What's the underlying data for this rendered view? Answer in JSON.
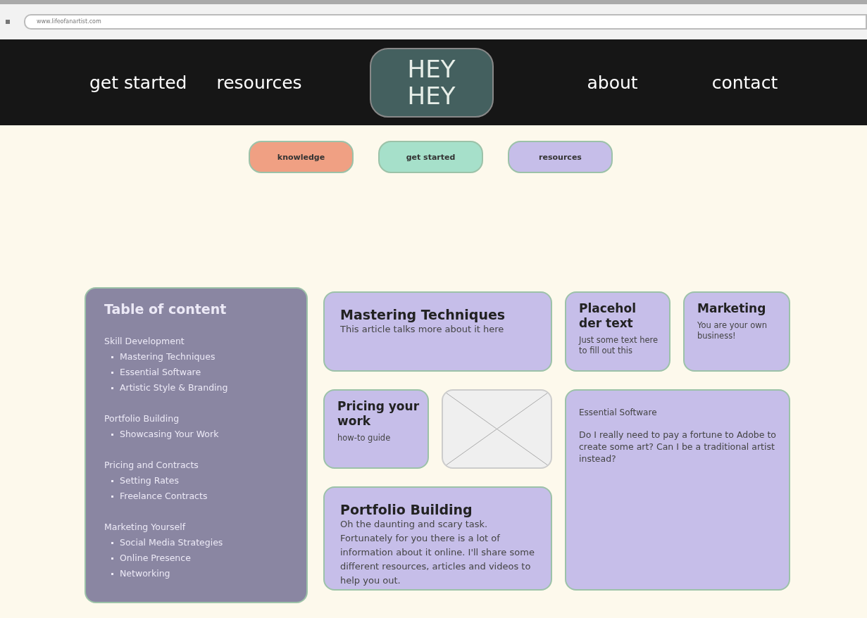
{
  "browser": {
    "address": "www.lifeofanartist.com"
  },
  "nav": {
    "left": [
      "get started",
      "resources"
    ],
    "logo": [
      "HEY",
      "HEY"
    ],
    "right": [
      "about",
      "contact"
    ]
  },
  "pills": [
    {
      "label": "knowledge",
      "color": "#f0a083"
    },
    {
      "label": "get started",
      "color": "#a6e0ca"
    },
    {
      "label": "resources",
      "color": "#c6bee9"
    }
  ],
  "toc": {
    "title": "Table of content",
    "sections": [
      {
        "heading": "Skill Development",
        "items": [
          "Mastering Techniques",
          "Essential Software",
          "Artistic Style & Branding"
        ]
      },
      {
        "heading": "Portfolio Building",
        "items": [
          "Showcasing Your Work"
        ]
      },
      {
        "heading": "Pricing and Contracts",
        "items": [
          "Setting Rates",
          "Freelance Contracts"
        ]
      },
      {
        "heading": "Marketing Yourself",
        "items": [
          "Social Media Strategies",
          "Online Presence",
          "Networking"
        ]
      }
    ]
  },
  "cards": [
    {
      "kind": "article",
      "title": "Mastering Techniques",
      "text": "This article talks more about it here"
    },
    {
      "kind": "small",
      "title": "Placehol der text",
      "text": "Just some text here to fill out this"
    },
    {
      "kind": "small",
      "title": "Marketing",
      "text": "You are your own business!"
    },
    {
      "kind": "small",
      "title": "Pricing your work",
      "text": "how-to guide"
    },
    {
      "kind": "image"
    },
    {
      "kind": "question",
      "title": "Essential Software",
      "text": "Do I really need to pay a fortune to Adobe to create some art? Can I be a traditional artist instead?"
    },
    {
      "kind": "article",
      "title": "Portfolio Building",
      "text": "Oh the daunting and scary task. Fortunately for you there is a lot of information about it online. I'll share some different resources, articles and videos to help you out."
    }
  ]
}
